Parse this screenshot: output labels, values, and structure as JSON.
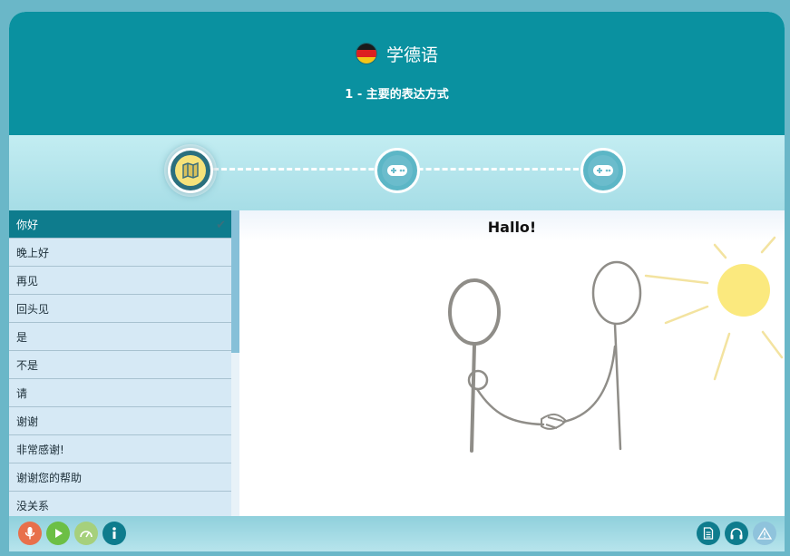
{
  "header": {
    "flag_icon": "germany-flag-icon",
    "app_title": "学德语",
    "lesson_title": "1 - 主要的表达方式"
  },
  "steps": [
    {
      "icon": "map-icon",
      "active": true
    },
    {
      "icon": "gamepad-icon",
      "active": false
    },
    {
      "icon": "gamepad-icon",
      "active": false
    }
  ],
  "phrases": [
    {
      "label": "你好",
      "active": true,
      "checked": true
    },
    {
      "label": "晚上好"
    },
    {
      "label": "再见"
    },
    {
      "label": "回头见"
    },
    {
      "label": "是"
    },
    {
      "label": "不是"
    },
    {
      "label": "请"
    },
    {
      "label": "谢谢"
    },
    {
      "label": "非常感谢!"
    },
    {
      "label": "谢谢您的帮助"
    },
    {
      "label": "没关系"
    }
  ],
  "main": {
    "title": "Hallo!",
    "illustration": "two-people-shaking-hands-with-sun"
  },
  "footer": {
    "left_buttons": [
      {
        "icon": "microphone-icon",
        "color": "#e8704b"
      },
      {
        "icon": "play-icon",
        "color": "#6cbf45"
      },
      {
        "icon": "speedometer-icon",
        "color": "#a6d07c"
      },
      {
        "icon": "info-icon",
        "color": "#0e7c8d"
      }
    ],
    "right_buttons": [
      {
        "icon": "document-icon",
        "color": "#0e7c8d"
      },
      {
        "icon": "headphones-icon",
        "color": "#0e7c8d"
      },
      {
        "icon": "warning-icon",
        "color": "#8fc3dc"
      }
    ]
  },
  "colors": {
    "header": "#0a91a0",
    "active_row": "#0e7c8d",
    "list_bg": "#d6e9f5",
    "sun": "#fbe97e"
  }
}
